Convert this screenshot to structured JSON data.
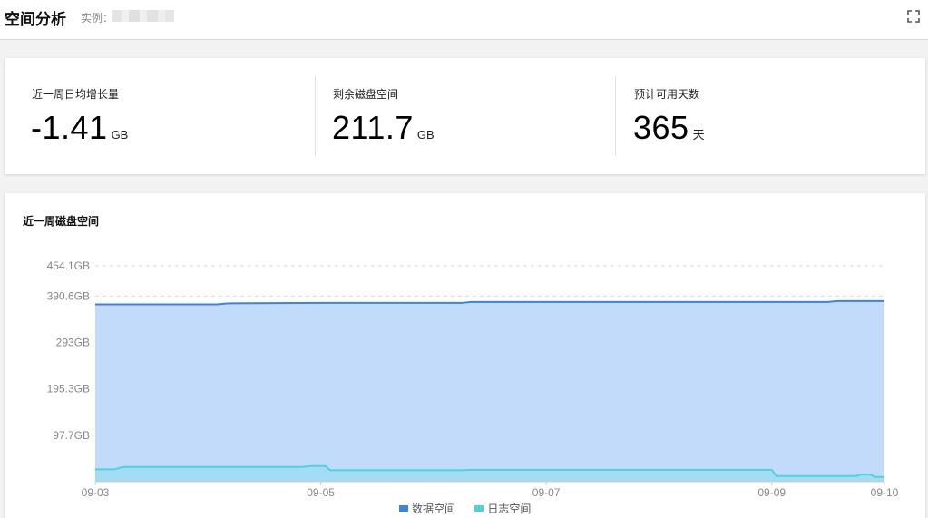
{
  "header": {
    "title": "空间分析",
    "instance_label": "实例：",
    "fullscreen_icon": "fullscreen-icon"
  },
  "stats": [
    {
      "label": "近一周日均增长量",
      "value": "-1.41",
      "unit": "GB"
    },
    {
      "label": "剩余磁盘空间",
      "value": "211.7",
      "unit": "GB"
    },
    {
      "label": "预计可用天数",
      "value": "365",
      "unit": "天"
    }
  ],
  "colors": {
    "data_line": "#3b82e6",
    "data_fill": "#c3dbfb",
    "log_line": "#4fd2d9",
    "log_fill": "#a3dcf5",
    "grid": "#d9d9d9",
    "axis_text": "#888888"
  },
  "chart_data": {
    "type": "area",
    "title": "近一周磁盘空间",
    "xlabel": "",
    "ylabel": "",
    "x_ticks": [
      "09-03",
      "09-05",
      "09-07",
      "09-09",
      "09-10"
    ],
    "x_range": [
      "09-03 00:00",
      "09-10 00:00"
    ],
    "y_ticks": [
      "97.7GB",
      "195.3GB",
      "293GB",
      "390.6GB",
      "454.1GB"
    ],
    "y_tick_values": [
      97.7,
      195.3,
      293,
      390.6,
      454.1
    ],
    "ylim": [
      0,
      454.1
    ],
    "grid": true,
    "legend_position": "bottom-center",
    "series": [
      {
        "name": "数据空间",
        "x": [
          "09-03 00:00",
          "09-04 02:00",
          "09-04 04:00",
          "09-05 00:00",
          "09-06 06:00",
          "09-06 08:00",
          "09-08 00:00",
          "09-09 12:00",
          "09-09 14:00",
          "09-10 00:00"
        ],
        "values": [
          373,
          373,
          375,
          376,
          376,
          378,
          378,
          378,
          380,
          380
        ]
      },
      {
        "name": "日志空间",
        "x": [
          "09-03 00:00",
          "09-03 04:00",
          "09-03 06:00",
          "09-04 20:00",
          "09-04 22:00",
          "09-05 01:00",
          "09-05 02:00",
          "09-06 06:00",
          "09-06 08:00",
          "09-08 00:00",
          "09-09 00:00",
          "09-09 01:00",
          "09-09 18:00",
          "09-09 19:00",
          "09-09 21:00",
          "09-09 22:00",
          "09-10 00:00"
        ],
        "values": [
          26,
          26,
          31,
          31,
          33,
          33,
          24,
          24,
          25,
          25,
          25,
          12,
          12,
          15,
          15,
          10,
          10
        ]
      }
    ]
  }
}
